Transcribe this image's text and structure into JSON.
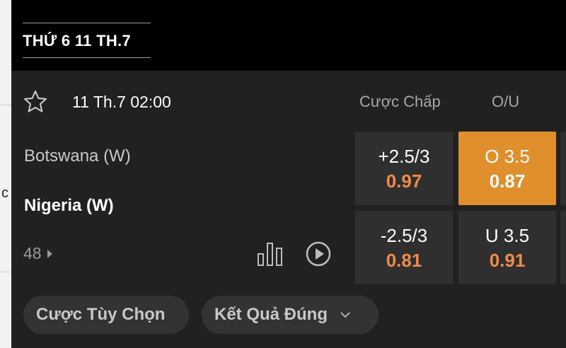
{
  "left_edge_char": "c",
  "header": {
    "date_label": "THỨ 6 11 TH.7"
  },
  "match": {
    "time": "11 Th.7 02:00",
    "home_team": "Botswana (W)",
    "away_team": "Nigeria (W)",
    "more_markets_count": "48"
  },
  "columns": {
    "handicap": "Cược Chấp",
    "ou": "O/U"
  },
  "odds": {
    "handicap_home": {
      "line": "+2.5/3",
      "price": "0.97"
    },
    "handicap_away": {
      "line": "-2.5/3",
      "price": "0.81"
    },
    "over": {
      "line": "O 3.5",
      "price": "0.87"
    },
    "under": {
      "line": "U 3.5",
      "price": "0.91"
    }
  },
  "buttons": {
    "custom_bet": "Cược Tùy Chọn",
    "correct_score": "Kết Quả Đúng"
  },
  "colors": {
    "accent": "#e08f2d",
    "price": "#f08a4b",
    "cell_bg": "#2f2f2f",
    "panel_bg": "#212121"
  }
}
